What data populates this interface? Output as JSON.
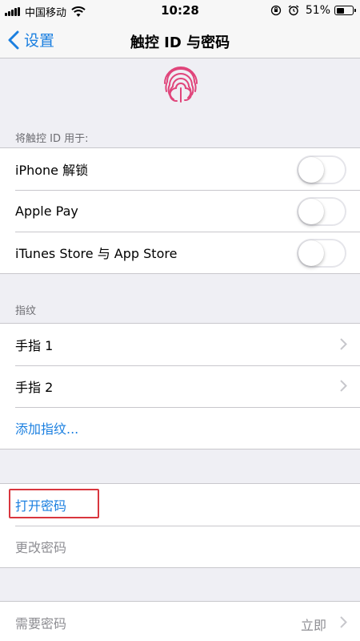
{
  "status_bar": {
    "carrier": "中国移动",
    "time": "10:28",
    "battery": "51%",
    "battery_level": 0.51
  },
  "nav": {
    "back_label": "设置",
    "title": "触控 ID 与密码"
  },
  "touch_id_section": {
    "header": "将触控 ID 用于:",
    "items": [
      {
        "label": "iPhone 解锁",
        "toggle": false
      },
      {
        "label": "Apple Pay",
        "toggle": false
      },
      {
        "label": "iTunes Store 与 App Store",
        "toggle": false
      }
    ]
  },
  "fingerprint_section": {
    "header": "指纹",
    "items": [
      {
        "label": "手指 1"
      },
      {
        "label": "手指 2"
      }
    ],
    "add_label": "添加指纹..."
  },
  "passcode_section": {
    "turn_on_label": "打开密码",
    "change_label": "更改密码"
  },
  "require_section": {
    "label": "需要密码",
    "value": "立即"
  },
  "colors": {
    "accent": "#1a7fe0",
    "highlight": "#d9363e",
    "fingerprint": "#e0457b"
  }
}
